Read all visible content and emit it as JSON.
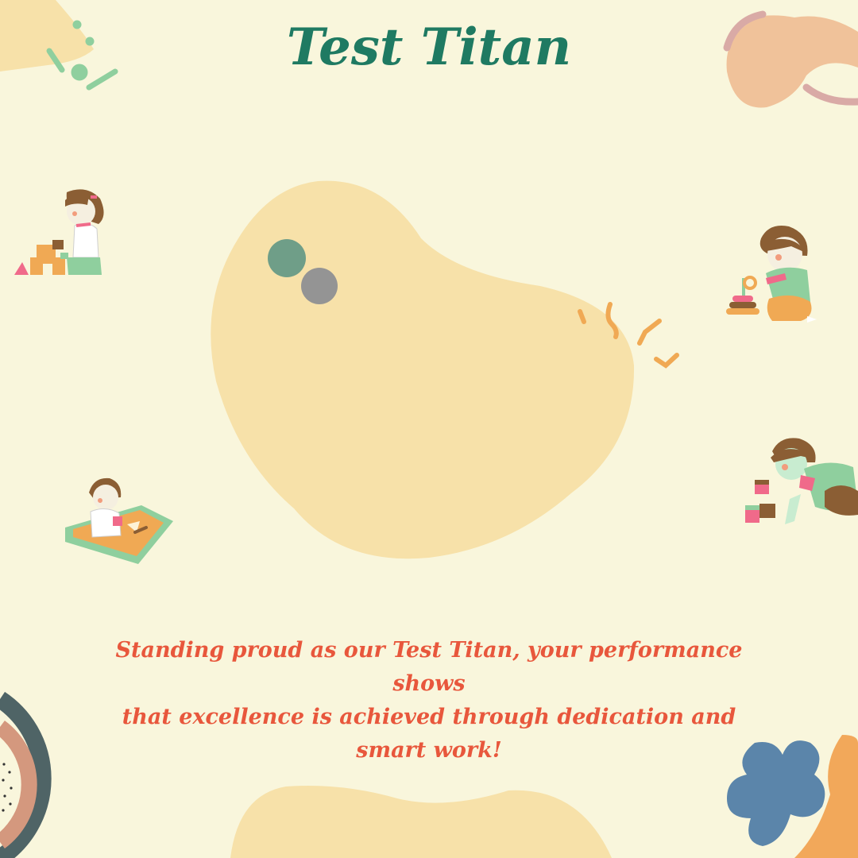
{
  "title": "Test Titan",
  "message": {
    "line1": "Standing proud as our Test Titan, your performance shows",
    "line2": "that excellence is achieved through dedication and smart work!"
  },
  "illustrations": [
    {
      "name": "girl-building-blocks-illustration"
    },
    {
      "name": "boy-stacking-rings-illustration"
    },
    {
      "name": "child-in-sandbox-illustration"
    },
    {
      "name": "child-crawling-with-blocks-illustration"
    }
  ],
  "colors": {
    "background": "#f9f6dc",
    "title": "#1f7a62",
    "message": "#e8573c",
    "blob": "#f7e1a9"
  }
}
